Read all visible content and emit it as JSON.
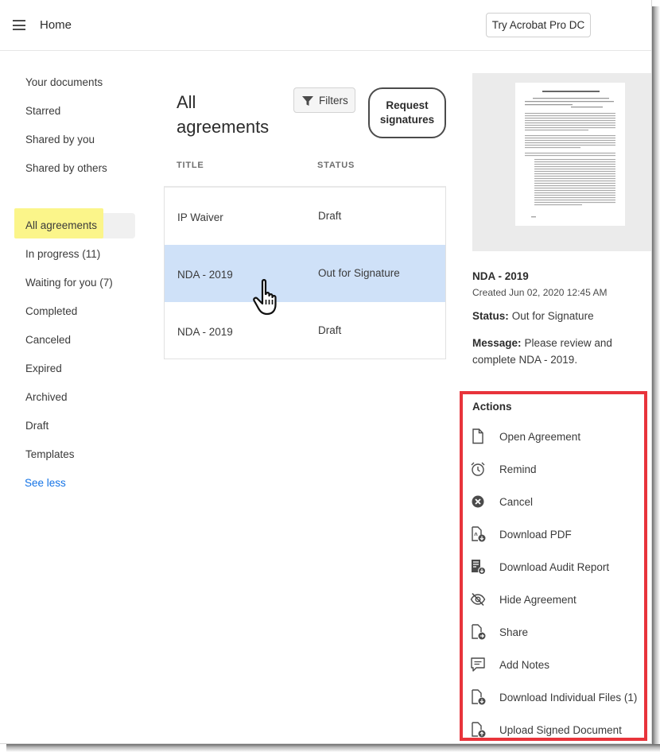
{
  "header": {
    "title": "Home",
    "try_button": "Try Acrobat Pro DC"
  },
  "sidebar": {
    "items": [
      {
        "label": "Your documents"
      },
      {
        "label": "Starred"
      },
      {
        "label": "Shared by you"
      },
      {
        "label": "Shared by others"
      },
      {
        "label": "All agreements",
        "active": true
      },
      {
        "label": "In progress (11)"
      },
      {
        "label": "Waiting for you (7)"
      },
      {
        "label": "Completed"
      },
      {
        "label": "Canceled"
      },
      {
        "label": "Expired"
      },
      {
        "label": "Archived"
      },
      {
        "label": "Draft"
      },
      {
        "label": "Templates"
      }
    ],
    "see_less": "See less"
  },
  "main": {
    "title": "All agreements",
    "filters_label": "Filters",
    "request_label": "Request signatures",
    "columns": {
      "title": "TITLE",
      "status": "STATUS"
    },
    "rows": [
      {
        "title": "IP Waiver",
        "status": "Draft",
        "selected": false
      },
      {
        "title": "NDA - 2019",
        "status": "Out for Signature",
        "selected": true
      },
      {
        "title": "NDA - 2019",
        "status": "Draft",
        "selected": false
      }
    ]
  },
  "detail": {
    "title": "NDA - 2019",
    "created": "Created Jun 02, 2020 12:45 AM",
    "status_label": "Status:",
    "status_value": "Out for Signature",
    "message_label": "Message:",
    "message_value": "Please review and complete NDA - 2019."
  },
  "actions": {
    "heading": "Actions",
    "items": [
      {
        "label": "Open Agreement",
        "icon": "document-icon"
      },
      {
        "label": "Remind",
        "icon": "alarm-clock-icon"
      },
      {
        "label": "Cancel",
        "icon": "cancel-circle-icon"
      },
      {
        "label": "Download PDF",
        "icon": "download-pdf-icon"
      },
      {
        "label": "Download Audit Report",
        "icon": "download-report-icon"
      },
      {
        "label": "Hide Agreement",
        "icon": "hide-eye-icon"
      },
      {
        "label": "Share",
        "icon": "share-document-icon"
      },
      {
        "label": "Add Notes",
        "icon": "notes-icon"
      },
      {
        "label": "Download Individual Files (1)",
        "icon": "download-files-icon"
      },
      {
        "label": "Upload Signed Document",
        "icon": "upload-document-icon"
      }
    ]
  },
  "colors": {
    "accent_link": "#1473e6",
    "selected_row": "#cfe1f8",
    "highlight": "#fbf58a",
    "annotation_border": "#e8343b"
  }
}
